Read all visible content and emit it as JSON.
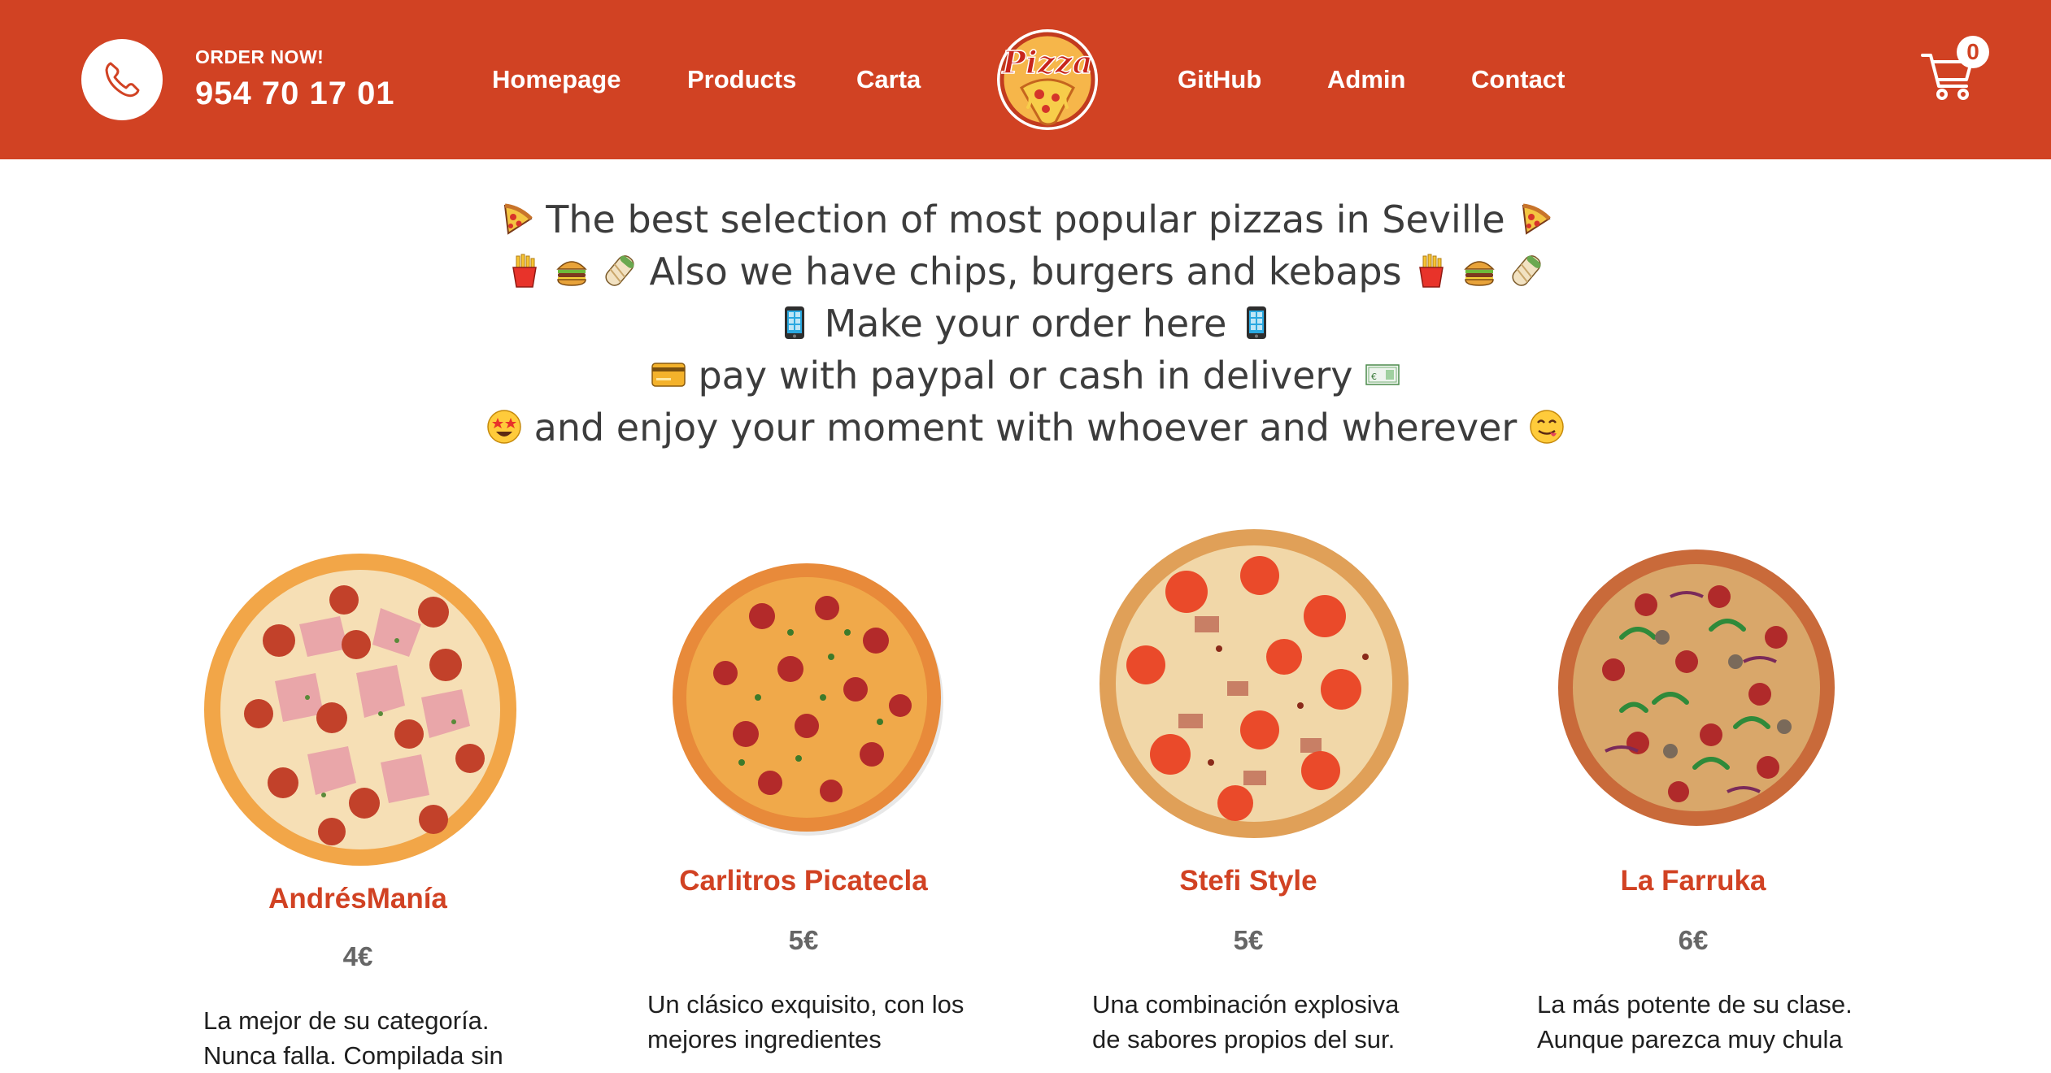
{
  "header": {
    "order_label": "ORDER NOW!",
    "phone_number": "954 70 17 01",
    "nav_left": [
      "Homepage",
      "Products",
      "Carta"
    ],
    "nav_right": [
      "GitHub",
      "Admin",
      "Contact"
    ],
    "logo_text": "Pizza",
    "cart_count": "0",
    "brand_color": "#d14223"
  },
  "intro": {
    "lines": [
      "The best selection of most popular pizzas in Seville",
      "Also we have chips, burgers and kebaps",
      "Make your order here",
      "pay with paypal or cash in delivery",
      "and enjoy your moment with whoever and wherever"
    ],
    "emoji": [
      "pizza",
      "fries",
      "burger",
      "kebab",
      "phone",
      "credit-card",
      "banknote",
      "star-struck-face",
      "yummy-face"
    ]
  },
  "products": [
    {
      "name": "AndrésManía",
      "price": "4€",
      "description": "La mejor de su categoría. Nunca falla. Compilada sin"
    },
    {
      "name": "Carlitros Picatecla",
      "price": "5€",
      "description": "Un clásico exquisito, con los mejores ingredientes"
    },
    {
      "name": "Stefi Style",
      "price": "5€",
      "description": "Una combinación explosiva de sabores propios del sur."
    },
    {
      "name": "La Farruka",
      "price": "6€",
      "description": "La más potente de su clase. Aunque parezca muy chula"
    }
  ]
}
